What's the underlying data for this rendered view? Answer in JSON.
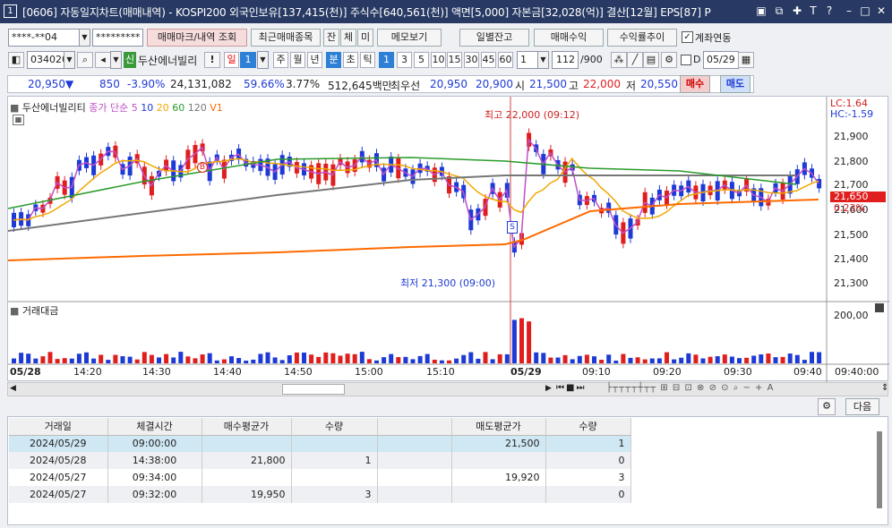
{
  "title": {
    "window_number": "1",
    "text": "[0606] 자동일지차트(매매내역) - KOSPI200 외국인보유[137,415(천)] 주식수[640,561(천)] 액면[5,000] 자본금[32,028(억)] 결산[12월] EPS[87] P"
  },
  "toolbar": {
    "account": "****-**04",
    "password": "*********",
    "trade_mark_btn": "매매마크/내역 조회",
    "recent_btn": "최근매매종목",
    "btn_jan": "잔",
    "btn_che": "체",
    "btn_mi": "미",
    "memo_btn": "메모보기",
    "daily_balance_btn": "일별잔고",
    "trade_return_btn": "매매수익",
    "return_trend_btn": "수익률추이",
    "account_link_label": "계좌연동"
  },
  "row2": {
    "code": "034020",
    "badge": "신",
    "stock_name": "두산에너빌리",
    "excl": "!",
    "period_il": "일",
    "period_num": "1",
    "periods": [
      "주",
      "월",
      "년"
    ],
    "bun": "분",
    "cho": "초",
    "tick": "틱",
    "minutes": [
      "1",
      "3",
      "5",
      "10",
      "15",
      "30",
      "45",
      "60"
    ],
    "minute_select": "1",
    "count": "112",
    "count_total": "/900",
    "date_checkbox": "D",
    "date": "05/29"
  },
  "quote": {
    "price": "20,950",
    "arrow": "▼",
    "change": "850",
    "pct": "-3.90%",
    "volume": "24,131,082",
    "ratio": "59.66%",
    "turnover": "3.77%",
    "amount": "512,645백만",
    "best_label": "최우선",
    "best_ask": "20,950",
    "best_bid": "20,900",
    "open_label": "시",
    "open": "21,500",
    "high_label": "고",
    "high": "22,000",
    "low_label": "저",
    "low": "20,550",
    "buy_btn": "매수",
    "sell_btn": "매도"
  },
  "chart": {
    "legend_name": "두산에너빌리티",
    "legend_ma": "종가 단순",
    "ma_periods": [
      "5",
      "10",
      "20",
      "60",
      "120"
    ],
    "v1": "V1",
    "lc": "LC:1.64",
    "hc": "HC:-1.59",
    "high_ann": "최고 22,000 (09:12)",
    "low_ann": "최저 21,300 (09:00)",
    "price_box": "21,650",
    "pct_box": "0.23%",
    "sub_title": "거래대금",
    "sub_max": "200,00",
    "mark_b": "B",
    "mark_s": "S",
    "colors": {
      "up": "#e01e1e",
      "down": "#1e3ad6",
      "ma5": "#c050c8",
      "ma10": "#1e3ad6",
      "ma20": "#f0a800",
      "ma60": "#2a9a2a",
      "ma120": "#777777",
      "v1": "#ff6a00"
    }
  },
  "chart_data": {
    "type": "candlestick",
    "y_ticks": [
      "21,900",
      "21,800",
      "21,700",
      "21,600",
      "21,500",
      "21,400",
      "21,300"
    ],
    "x_ticks": [
      "05/28",
      "14:20",
      "14:30",
      "14:40",
      "14:50",
      "15:00",
      "15:10",
      "05/29",
      "09:10",
      "09:20",
      "09:30",
      "09:40",
      "09:40:00"
    ]
  },
  "table": {
    "headers": [
      "거래일",
      "체결시간",
      "매수평균가",
      "수량",
      "",
      "매도평균가",
      "수량"
    ],
    "rows": [
      [
        "2024/05/29",
        "09:00:00",
        "",
        "",
        "",
        "21,500",
        "1"
      ],
      [
        "2024/05/28",
        "14:38:00",
        "21,800",
        "1",
        "",
        "",
        "0"
      ],
      [
        "2024/05/27",
        "09:34:00",
        "",
        "",
        "",
        "19,920",
        "3"
      ],
      [
        "2024/05/27",
        "09:32:00",
        "19,950",
        "3",
        "",
        "",
        "0"
      ]
    ],
    "next_btn": "다음"
  }
}
